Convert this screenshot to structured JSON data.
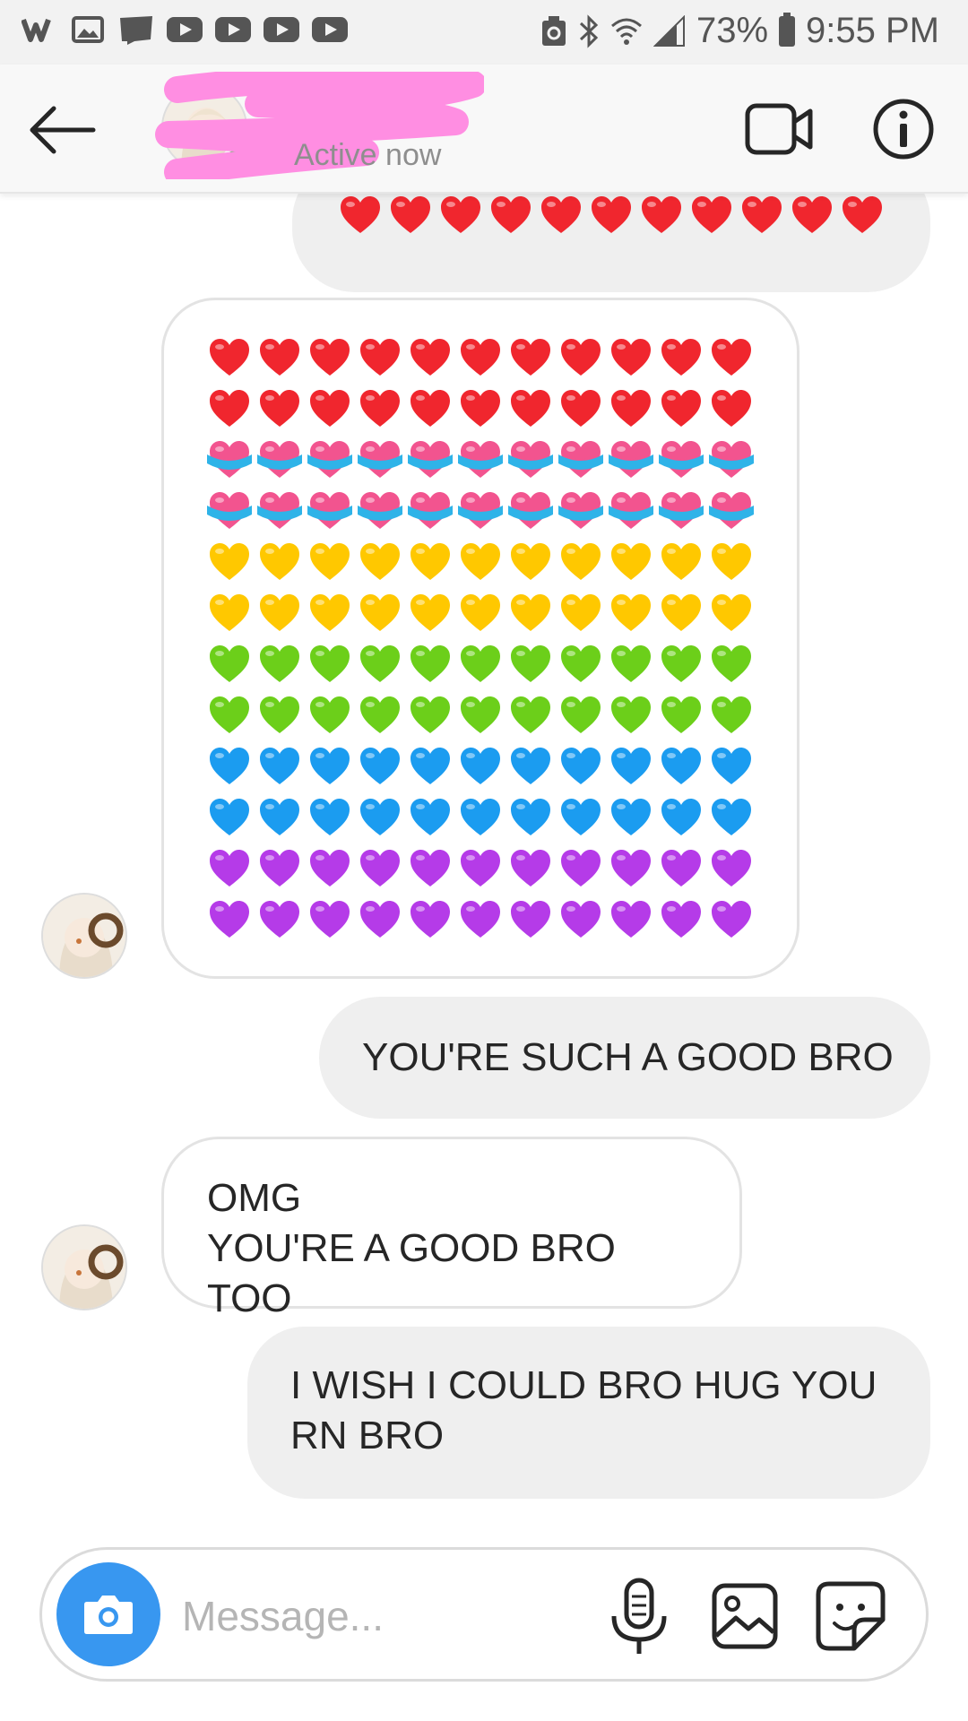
{
  "status_bar": {
    "battery_percent": "73%",
    "time": "9:55 PM",
    "app_icons": [
      "webtoon-w-icon",
      "gallery-icon",
      "webtoon-icon",
      "youtube-icon",
      "youtube-icon",
      "youtube-icon",
      "youtube-icon"
    ],
    "system_icons": [
      "recycle-icon",
      "bluetooth-icon",
      "wifi-icon",
      "signal-icon",
      "battery-icon"
    ]
  },
  "header": {
    "contact_name": "",
    "status": "Active now",
    "back_icon": "back-arrow-icon",
    "video_icon": "video-call-icon",
    "info_icon": "info-icon"
  },
  "messages": [
    {
      "from": "me",
      "type": "emoji",
      "content": "❤️❤️❤️❤️❤️❤️❤️❤️❤️❤️❤️"
    },
    {
      "from": "them",
      "type": "emoji-grid",
      "rows": [
        [
          "red",
          "red",
          "red",
          "red",
          "red",
          "red",
          "red",
          "red",
          "red",
          "red",
          "red"
        ],
        [
          "red",
          "red",
          "red",
          "red",
          "red",
          "red",
          "red",
          "red",
          "red",
          "red",
          "red"
        ],
        [
          "ribbon",
          "ribbon",
          "ribbon",
          "ribbon",
          "ribbon",
          "ribbon",
          "ribbon",
          "ribbon",
          "ribbon",
          "ribbon",
          "ribbon"
        ],
        [
          "ribbon",
          "ribbon",
          "ribbon",
          "ribbon",
          "ribbon",
          "ribbon",
          "ribbon",
          "ribbon",
          "ribbon",
          "ribbon",
          "ribbon"
        ],
        [
          "yellow",
          "yellow",
          "yellow",
          "yellow",
          "yellow",
          "yellow",
          "yellow",
          "yellow",
          "yellow",
          "yellow",
          "yellow"
        ],
        [
          "yellow",
          "yellow",
          "yellow",
          "yellow",
          "yellow",
          "yellow",
          "yellow",
          "yellow",
          "yellow",
          "yellow",
          "yellow"
        ],
        [
          "green",
          "green",
          "green",
          "green",
          "green",
          "green",
          "green",
          "green",
          "green",
          "green",
          "green"
        ],
        [
          "green",
          "green",
          "green",
          "green",
          "green",
          "green",
          "green",
          "green",
          "green",
          "green",
          "green"
        ],
        [
          "blue",
          "blue",
          "blue",
          "blue",
          "blue",
          "blue",
          "blue",
          "blue",
          "blue",
          "blue",
          "blue"
        ],
        [
          "blue",
          "blue",
          "blue",
          "blue",
          "blue",
          "blue",
          "blue",
          "blue",
          "blue",
          "blue",
          "blue"
        ],
        [
          "purple",
          "purple",
          "purple",
          "purple",
          "purple",
          "purple",
          "purple",
          "purple",
          "purple",
          "purple",
          "purple"
        ],
        [
          "purple",
          "purple",
          "purple",
          "purple",
          "purple",
          "purple",
          "purple",
          "purple",
          "purple",
          "purple",
          "purple"
        ]
      ]
    },
    {
      "from": "me",
      "type": "text",
      "text": "YOU'RE SUCH A GOOD BRO"
    },
    {
      "from": "them",
      "type": "text",
      "line1": "OMG",
      "line2": "YOU'RE A GOOD BRO TOO"
    },
    {
      "from": "me",
      "type": "text",
      "line1": "I WISH I COULD BRO HUG YOU",
      "line2": "RN BRO"
    }
  ],
  "composer": {
    "placeholder": "Message...",
    "camera_icon": "camera-icon",
    "mic_icon": "microphone-icon",
    "gallery_icon": "gallery-icon",
    "sticker_icon": "sticker-icon"
  },
  "colors": {
    "red": "#f0262e",
    "ribbon": "#f2548f",
    "yellow": "#ffc800",
    "green": "#6ccf1a",
    "blue": "#1b9cf0",
    "purple": "#b53be8",
    "accent": "#3897f0",
    "active_dot": "#3fc94c",
    "redaction": "#ff8ee2"
  }
}
